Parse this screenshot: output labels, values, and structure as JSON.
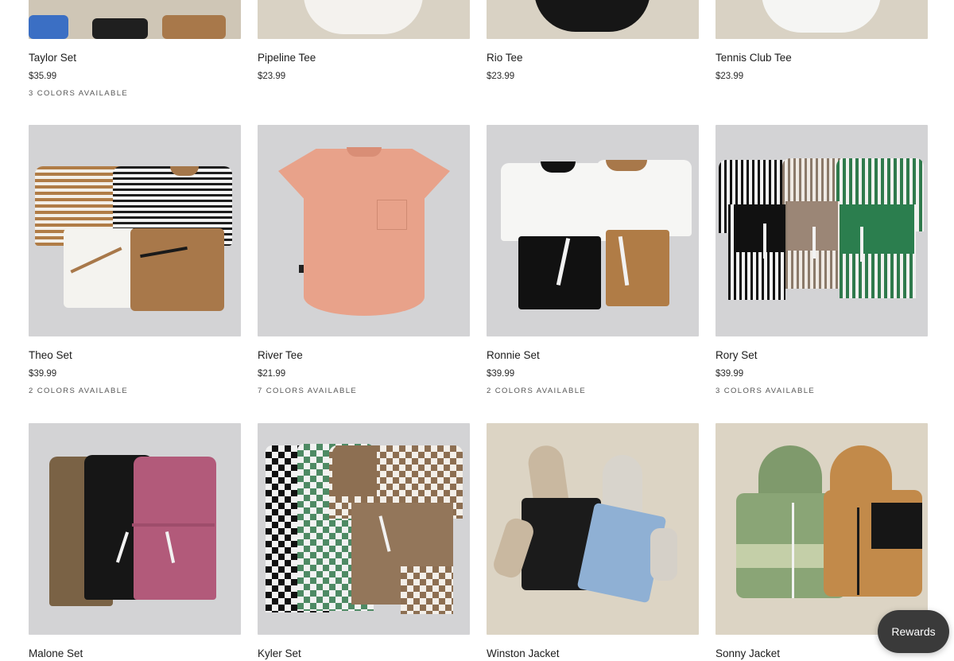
{
  "products": [
    {
      "name": "Taylor Set",
      "price": "$35.99",
      "colors": "3 COLORS AVAILABLE"
    },
    {
      "name": "Pipeline Tee",
      "price": "$23.99",
      "colors": ""
    },
    {
      "name": "Rio Tee",
      "price": "$23.99",
      "colors": ""
    },
    {
      "name": "Tennis Club Tee",
      "price": "$23.99",
      "colors": ""
    },
    {
      "name": "Theo Set",
      "price": "$39.99",
      "colors": "2 COLORS AVAILABLE"
    },
    {
      "name": "River Tee",
      "price": "$21.99",
      "colors": "7 COLORS AVAILABLE"
    },
    {
      "name": "Ronnie Set",
      "price": "$39.99",
      "colors": "2 COLORS AVAILABLE"
    },
    {
      "name": "Rory Set",
      "price": "$39.99",
      "colors": "3 COLORS AVAILABLE"
    },
    {
      "name": "Malone Set",
      "price": "",
      "colors": ""
    },
    {
      "name": "Kyler Set",
      "price": "",
      "colors": ""
    },
    {
      "name": "Winston Jacket",
      "price": "",
      "colors": ""
    },
    {
      "name": "Sonny Jacket",
      "price": "",
      "colors": ""
    }
  ],
  "rewards_label": "Rewards",
  "colors": {
    "photo_gray": "#d3d3d5",
    "photo_beige": "#dcd4c4",
    "rewards_bg": "#3a3a3a"
  }
}
